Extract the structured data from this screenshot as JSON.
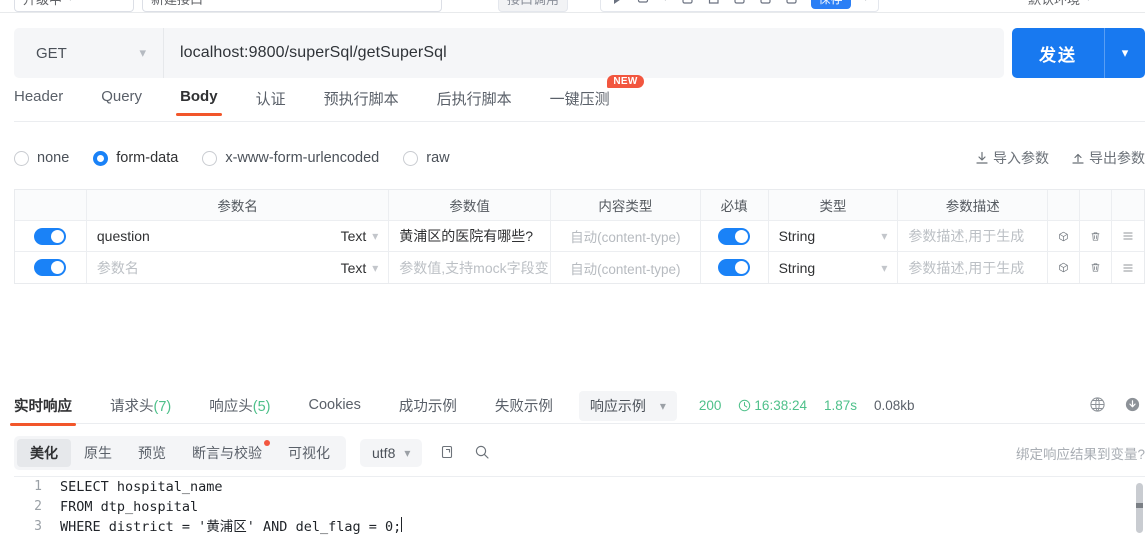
{
  "topbar": {
    "left_select_label": "升级中",
    "left_name_value": "新建接口",
    "mock_button": "接口调用",
    "save_button": "保存",
    "env_select": "默认环境"
  },
  "request": {
    "method": "GET",
    "url": "localhost:9800/superSql/getSuperSql",
    "send_label": "发送"
  },
  "tabs": [
    {
      "label": "Header",
      "active": false
    },
    {
      "label": "Query",
      "active": false
    },
    {
      "label": "Body",
      "active": true
    },
    {
      "label": "认证",
      "active": false
    },
    {
      "label": "预执行脚本",
      "active": false
    },
    {
      "label": "后执行脚本",
      "active": false
    },
    {
      "label": "一键压测",
      "active": false,
      "badge": "NEW"
    }
  ],
  "body_types": [
    {
      "label": "none",
      "selected": false
    },
    {
      "label": "form-data",
      "selected": true
    },
    {
      "label": "x-www-form-urlencoded",
      "selected": false
    },
    {
      "label": "raw",
      "selected": false
    }
  ],
  "io_actions": [
    {
      "label": "导入参数",
      "icon": "import-icon"
    },
    {
      "label": "导出参数",
      "icon": "export-icon"
    }
  ],
  "params_table": {
    "headers": [
      "",
      "参数名",
      "参数值",
      "内容类型",
      "必填",
      "类型",
      "参数描述",
      "",
      "",
      ""
    ],
    "rows": [
      {
        "enabled": true,
        "name": "question",
        "name_is_placeholder": false,
        "name_type": "Text",
        "value": "黄浦区的医院有哪些?",
        "value_is_placeholder": false,
        "content_type": "自动(content-type)",
        "required": true,
        "type": "String",
        "desc": "参数描述,用于生成",
        "desc_is_placeholder": true
      },
      {
        "enabled": true,
        "name": "参数名",
        "name_is_placeholder": true,
        "name_type": "Text",
        "value": "参数值,支持mock字段变",
        "value_is_placeholder": true,
        "content_type": "自动(content-type)",
        "required": true,
        "type": "String",
        "desc": "参数描述,用于生成",
        "desc_is_placeholder": true
      }
    ],
    "row_icons": [
      "cube-icon",
      "trash-icon",
      "menu-icon"
    ]
  },
  "response": {
    "tabs": [
      {
        "label": "实时响应",
        "count": "",
        "active": true
      },
      {
        "label": "请求头",
        "count": "(7)",
        "active": false
      },
      {
        "label": "响应头",
        "count": "(5)",
        "active": false
      },
      {
        "label": "Cookies",
        "count": "",
        "active": false
      },
      {
        "label": "成功示例",
        "count": "",
        "active": false
      },
      {
        "label": "失败示例",
        "count": "",
        "active": false
      }
    ],
    "example_select": "响应示例",
    "status": "200",
    "time": "16:38:24",
    "duration": "1.87s",
    "size": "0.08kb"
  },
  "formatter": {
    "tabs": [
      {
        "label": "美化",
        "active": true,
        "dot": false
      },
      {
        "label": "原生",
        "active": false,
        "dot": false
      },
      {
        "label": "预览",
        "active": false,
        "dot": false
      },
      {
        "label": "断言与校验",
        "active": false,
        "dot": true
      },
      {
        "label": "可视化",
        "active": false,
        "dot": false
      }
    ],
    "encoding": "utf8",
    "bind_hint": "绑定响应结果到变量?"
  },
  "code": {
    "lines": [
      {
        "num": "1",
        "text": "SELECT hospital_name"
      },
      {
        "num": "2",
        "text": "FROM dtp_hospital"
      },
      {
        "num": "3",
        "text": "WHERE district = '黄浦区' AND del_flag = 0;"
      }
    ]
  },
  "colors": {
    "accent_orange": "#f2562a",
    "primary_blue": "#1879f0",
    "success_green": "#4ec08a",
    "badge_red": "#f2563f"
  }
}
